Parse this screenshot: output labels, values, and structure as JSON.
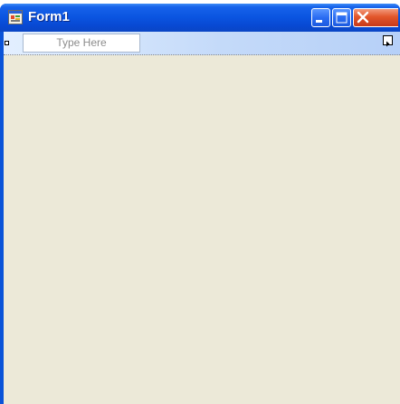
{
  "window": {
    "title": "Form1",
    "app_icon": "form-icon",
    "controls": {
      "minimize_icon": "minimize-icon",
      "maximize_icon": "maximize-icon",
      "close_icon": "close-icon"
    }
  },
  "menustrip": {
    "placeholder": "Type Here"
  },
  "designer": {
    "selection_handle": "resize-handle",
    "smart_tag": "smart-tag-arrow-icon"
  },
  "colors": {
    "titlebar": "#0a54e0",
    "client_background": "#ece9d8",
    "close_button": "#e2562a"
  }
}
